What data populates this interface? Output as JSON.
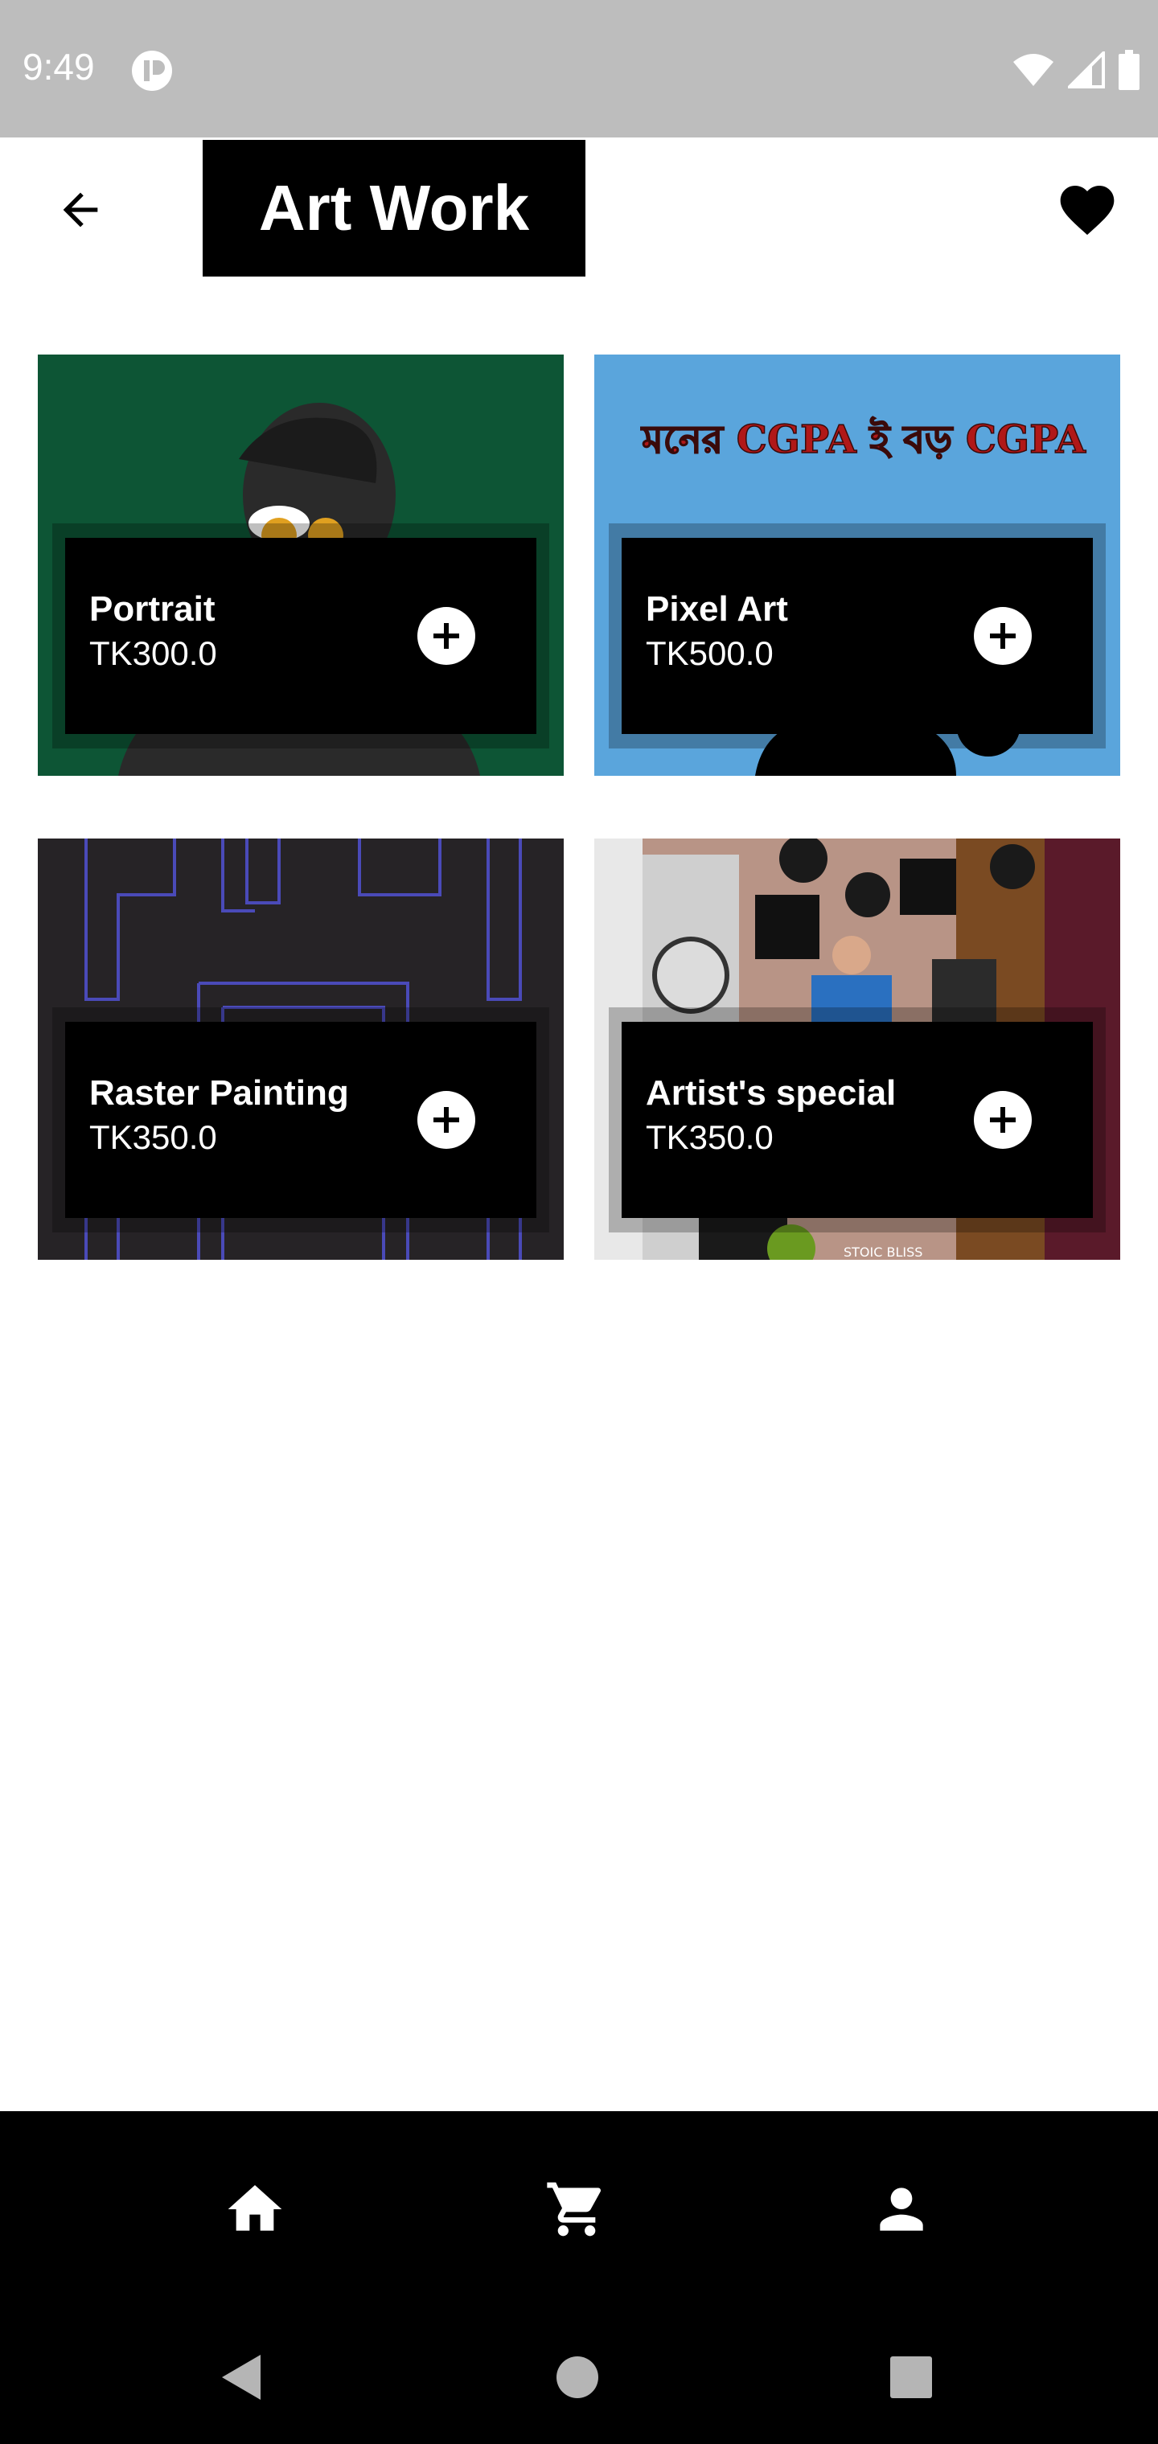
{
  "status_bar": {
    "time": "9:49",
    "app_icon": "notification-app-icon",
    "wifi_icon": "wifi-icon",
    "signal_icon": "cell-signal-icon",
    "battery_icon": "battery-icon"
  },
  "app_bar": {
    "title": "Art Work",
    "back_icon": "arrow-back-icon",
    "favorite_icon": "heart-icon"
  },
  "products": [
    {
      "name": "Portrait",
      "price": "TK300.0",
      "add_icon": "add-circle-icon"
    },
    {
      "name": "Pixel Art",
      "price": "TK500.0",
      "add_icon": "add-circle-icon",
      "image_text": "মনের CGPA ই বড় CGPA"
    },
    {
      "name": "Raster Painting",
      "price": "TK350.0",
      "add_icon": "add-circle-icon"
    },
    {
      "name": "Artist's special",
      "price": "TK350.0",
      "add_icon": "add-circle-icon",
      "image_text": "STOIC BLISS"
    }
  ],
  "bottom_nav": {
    "items": [
      {
        "icon": "home-icon"
      },
      {
        "icon": "cart-icon"
      },
      {
        "icon": "person-icon"
      }
    ]
  },
  "system_nav": {
    "back": "nav-back-icon",
    "home": "nav-home-icon",
    "recents": "nav-recents-icon"
  },
  "colors": {
    "status_bar": "#bdbdbd",
    "app_bar_title_bg": "#000000",
    "card_overlay": "#000000",
    "portrait_bg": "#0d5535",
    "pixel_art_bg": "#5aa5dc",
    "raster_bg": "#262326",
    "nav_bg": "#000000"
  }
}
